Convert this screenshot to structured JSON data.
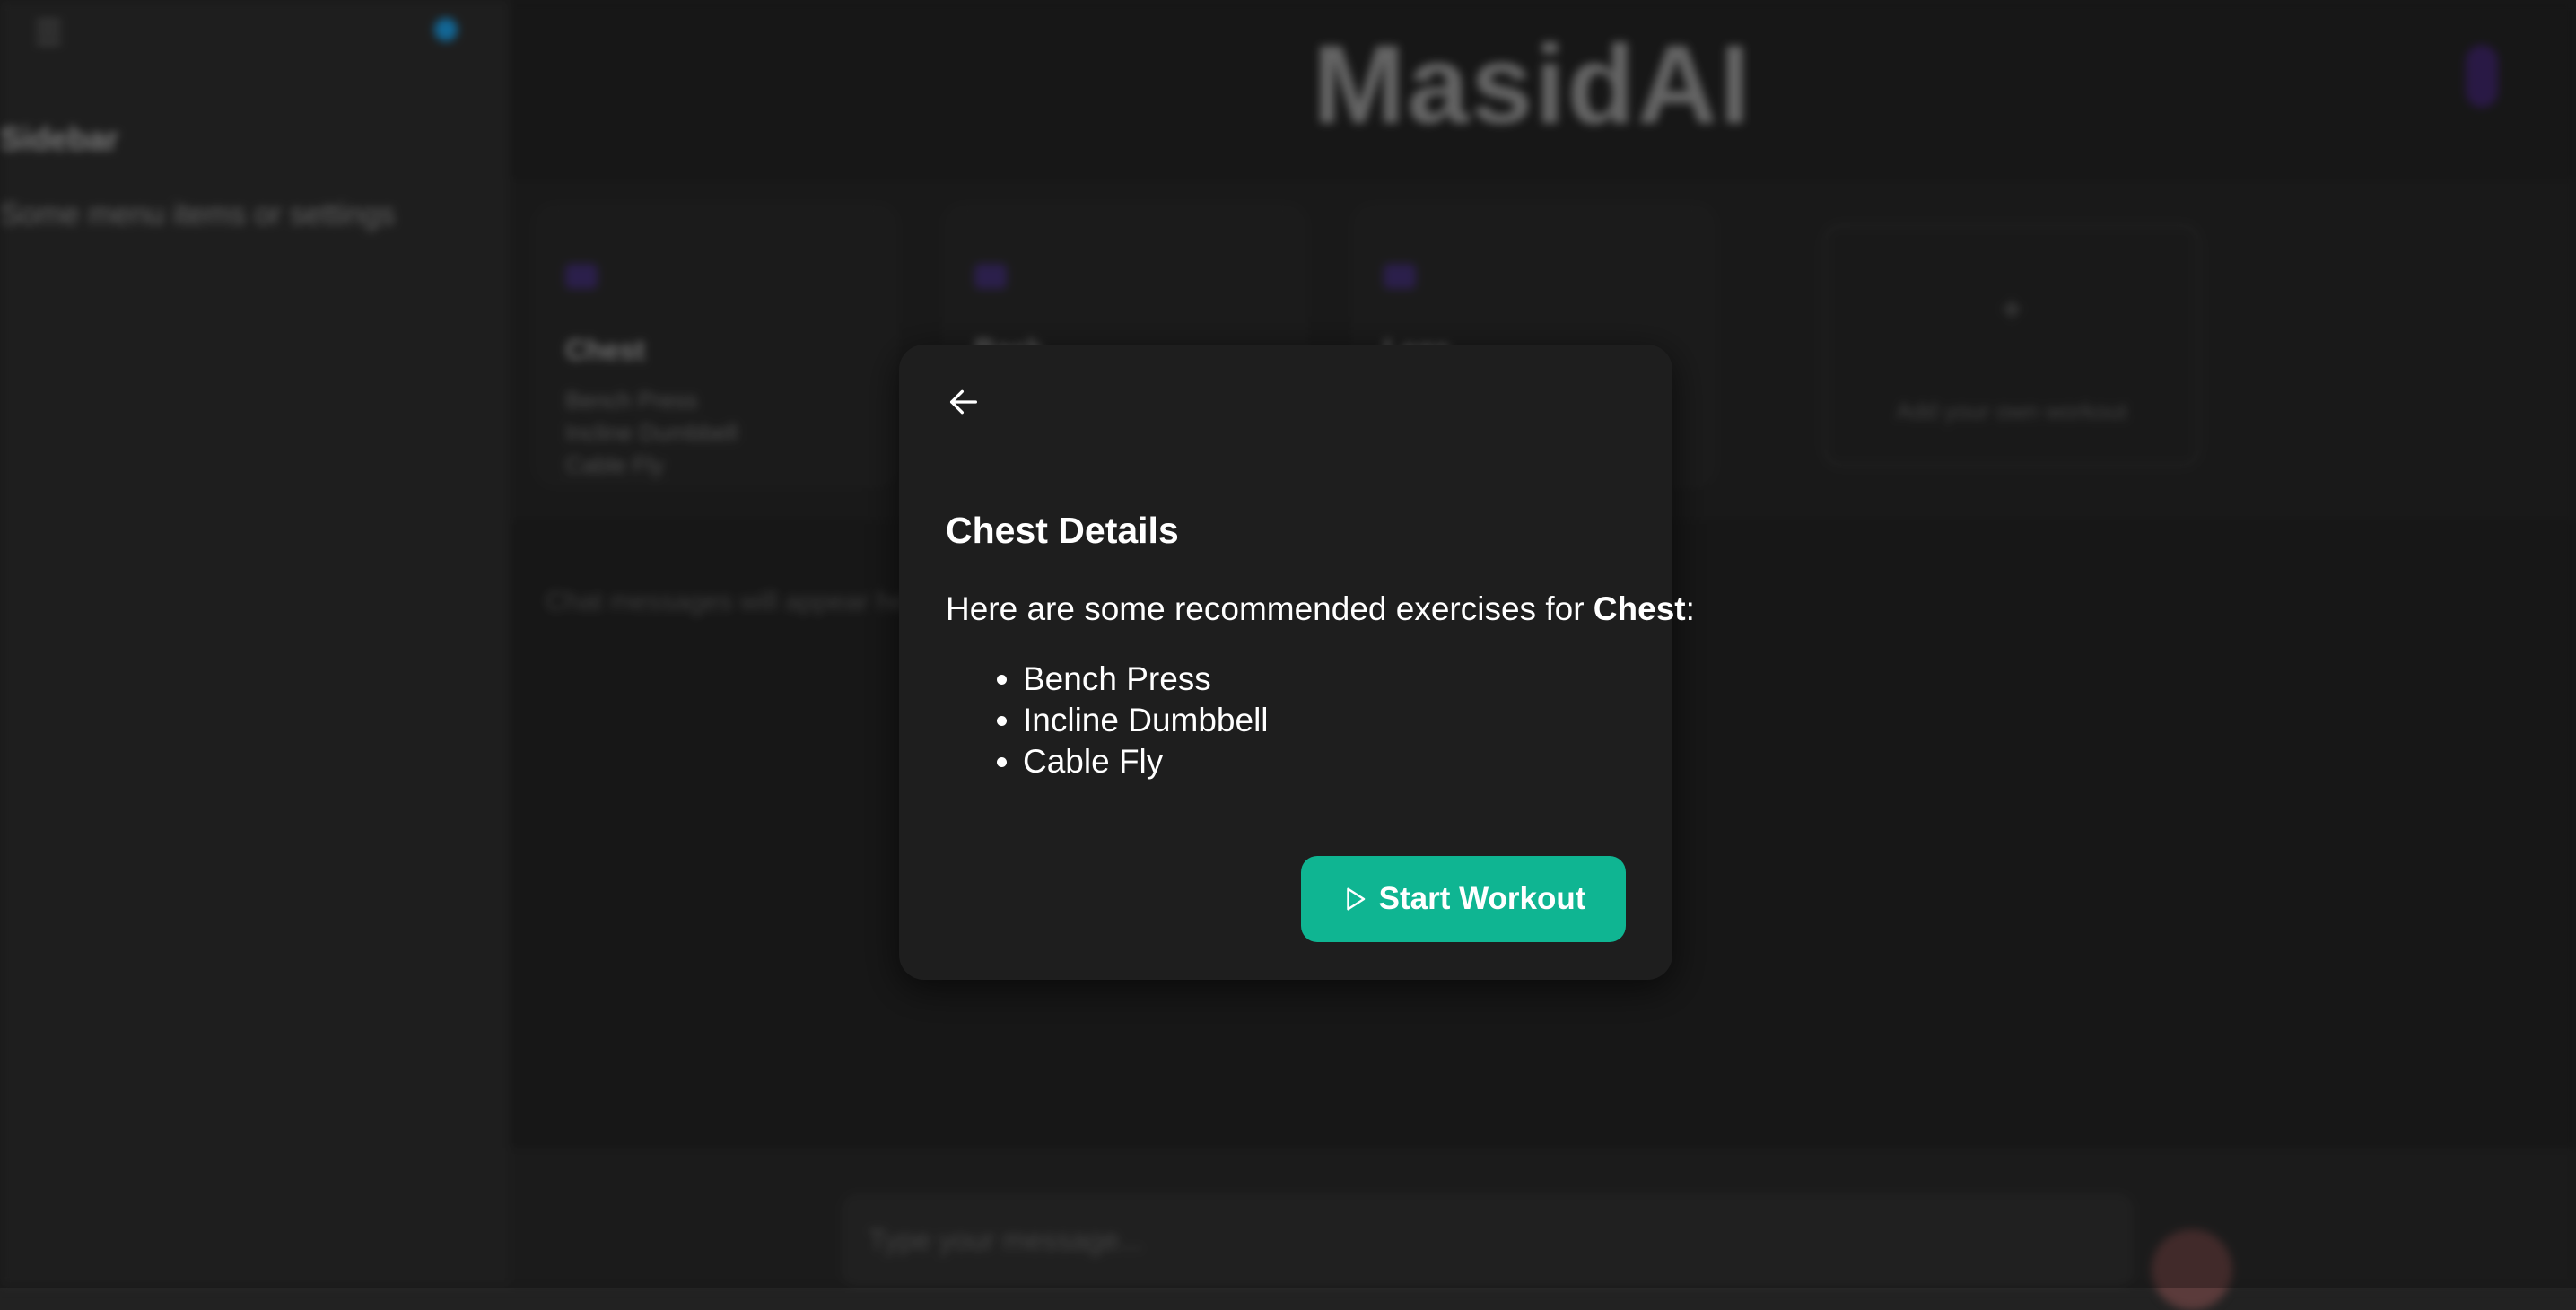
{
  "app": {
    "brand": "MasidAI"
  },
  "sidebar": {
    "title": "Sidebar",
    "text": "Some menu items or settings"
  },
  "cards": [
    {
      "title": "Chest",
      "items": [
        "Bench Press",
        "Incline Dumbbell",
        "Cable Fly"
      ]
    },
    {
      "title": "Back",
      "items": []
    },
    {
      "title": "Legs",
      "items": []
    }
  ],
  "add_card": {
    "plus": "+",
    "label": "Add your own workout"
  },
  "chat": {
    "empty_text": "Chat messages will appear here"
  },
  "composer": {
    "placeholder": "Type your message..."
  },
  "modal": {
    "title": "Chest Details",
    "desc_prefix": "Here are some recommended exercises for ",
    "desc_bold": "Chest",
    "desc_suffix": ":",
    "exercises": [
      "Bench Press",
      "Incline Dumbbell",
      "Cable Fly"
    ],
    "start_label": "Start Workout"
  },
  "colors": {
    "accent": "#0fb592",
    "status_dot": "#1a8fd0",
    "modal_bg": "#1e1e1e"
  },
  "icons": {
    "back": "arrow-left-icon",
    "start": "play-icon",
    "menu": "hamburger-icon",
    "mic": "mic-icon"
  }
}
